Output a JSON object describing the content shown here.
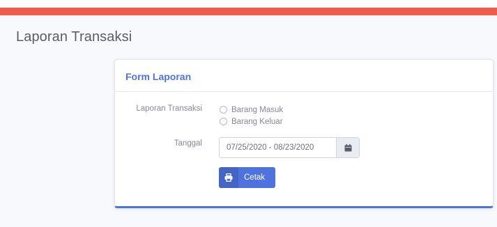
{
  "page": {
    "title": "Laporan Transaksi"
  },
  "card": {
    "title": "Form Laporan"
  },
  "form": {
    "laporan_label": "Laporan Transaksi",
    "options": [
      {
        "label": "Barang Masuk",
        "selected": false
      },
      {
        "label": "Barang Keluar",
        "selected": false
      }
    ],
    "tanggal_label": "Tanggal",
    "date_range_value": "07/25/2020 - 08/23/2020",
    "calendar_icon": "calendar-icon",
    "print_button_label": "Cetak",
    "print_icon": "print-icon"
  },
  "colors": {
    "top_accent": "#f15a4a",
    "primary": "#4e73df",
    "text_muted": "#858796"
  }
}
